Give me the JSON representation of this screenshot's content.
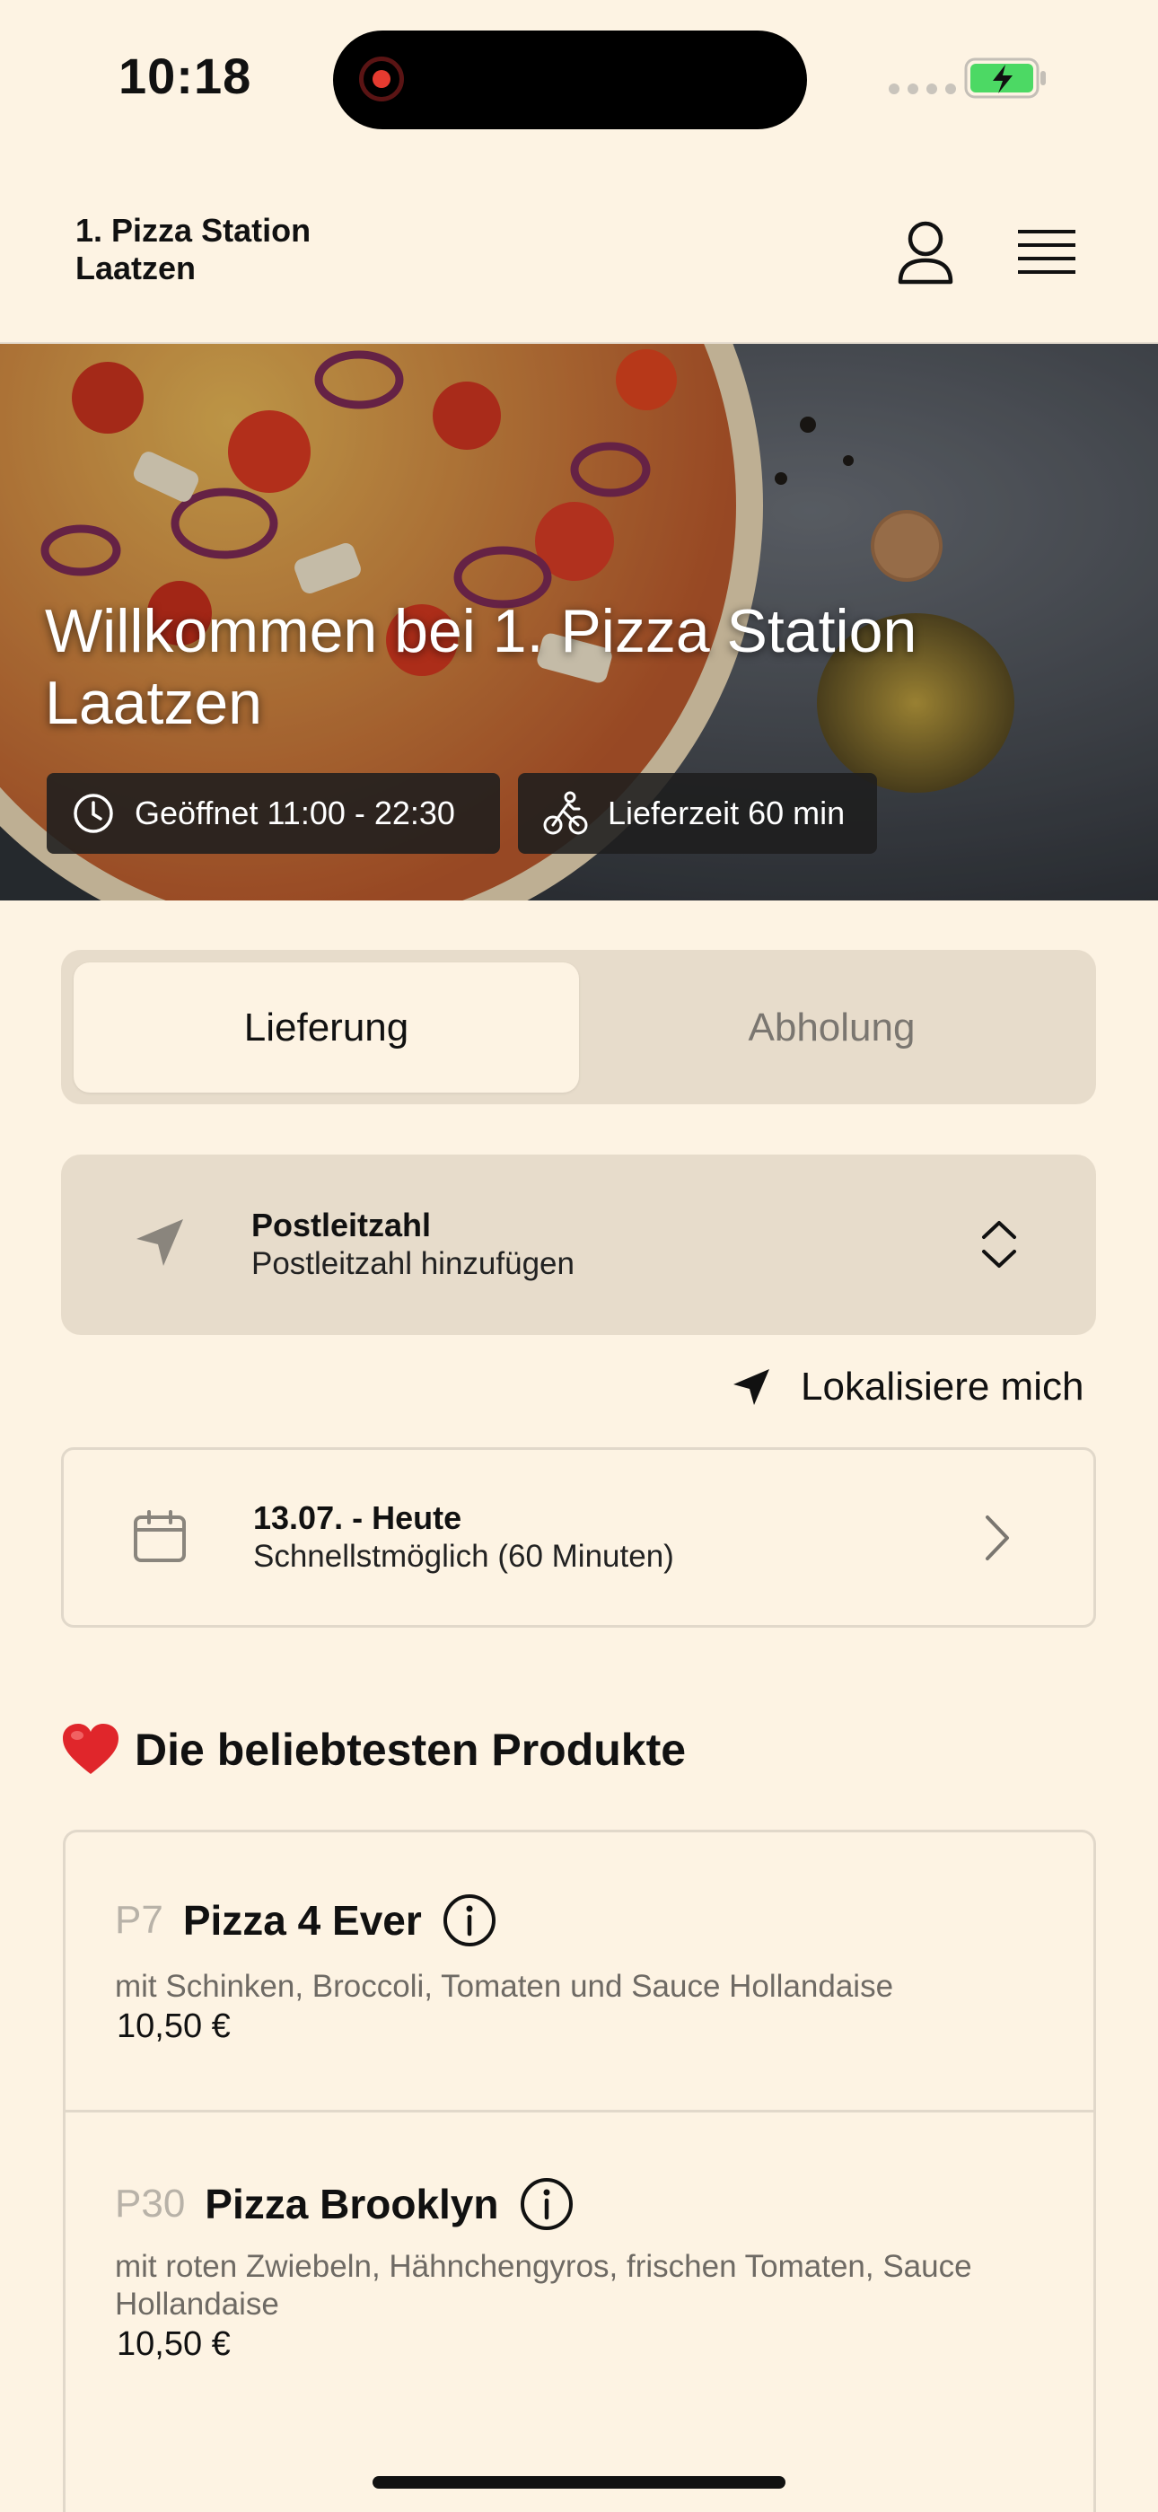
{
  "status_bar": {
    "time": "10:18"
  },
  "header": {
    "brand": "1. Pizza Station\nLaatzen"
  },
  "hero": {
    "title": "Willkommen bei 1. Pizza Station Laatzen",
    "opening_hours": "Geöffnet 11:00 - 22:30",
    "delivery_time": "Lieferzeit 60 min"
  },
  "mode_tabs": {
    "delivery": "Lieferung",
    "pickup": "Abholung",
    "selected": "Lieferung"
  },
  "postcode": {
    "label": "Postleitzahl",
    "placeholder": "Postleitzahl hinzufügen"
  },
  "locate_me": "Lokalisiere mich",
  "schedule": {
    "date": "13.07. - Heute",
    "time": "Schnellstmöglich (60 Minuten)"
  },
  "popular": {
    "title": "Die beliebtesten Produkte",
    "products": [
      {
        "code": "P7",
        "name": "Pizza 4 Ever",
        "description": "mit Schinken, Broccoli, Tomaten und Sauce  Hollandaise",
        "price": "10,50 €"
      },
      {
        "code": "P30",
        "name": "Pizza Brooklyn",
        "description": "mit roten Zwiebeln, Hähnchengyros, frischen Tomaten, Sauce Hollandaise",
        "price": "10,50 €"
      }
    ]
  },
  "colors": {
    "background": "#fdf3e3",
    "segment_bg": "#e7dccb",
    "battery": "#4cd964"
  }
}
